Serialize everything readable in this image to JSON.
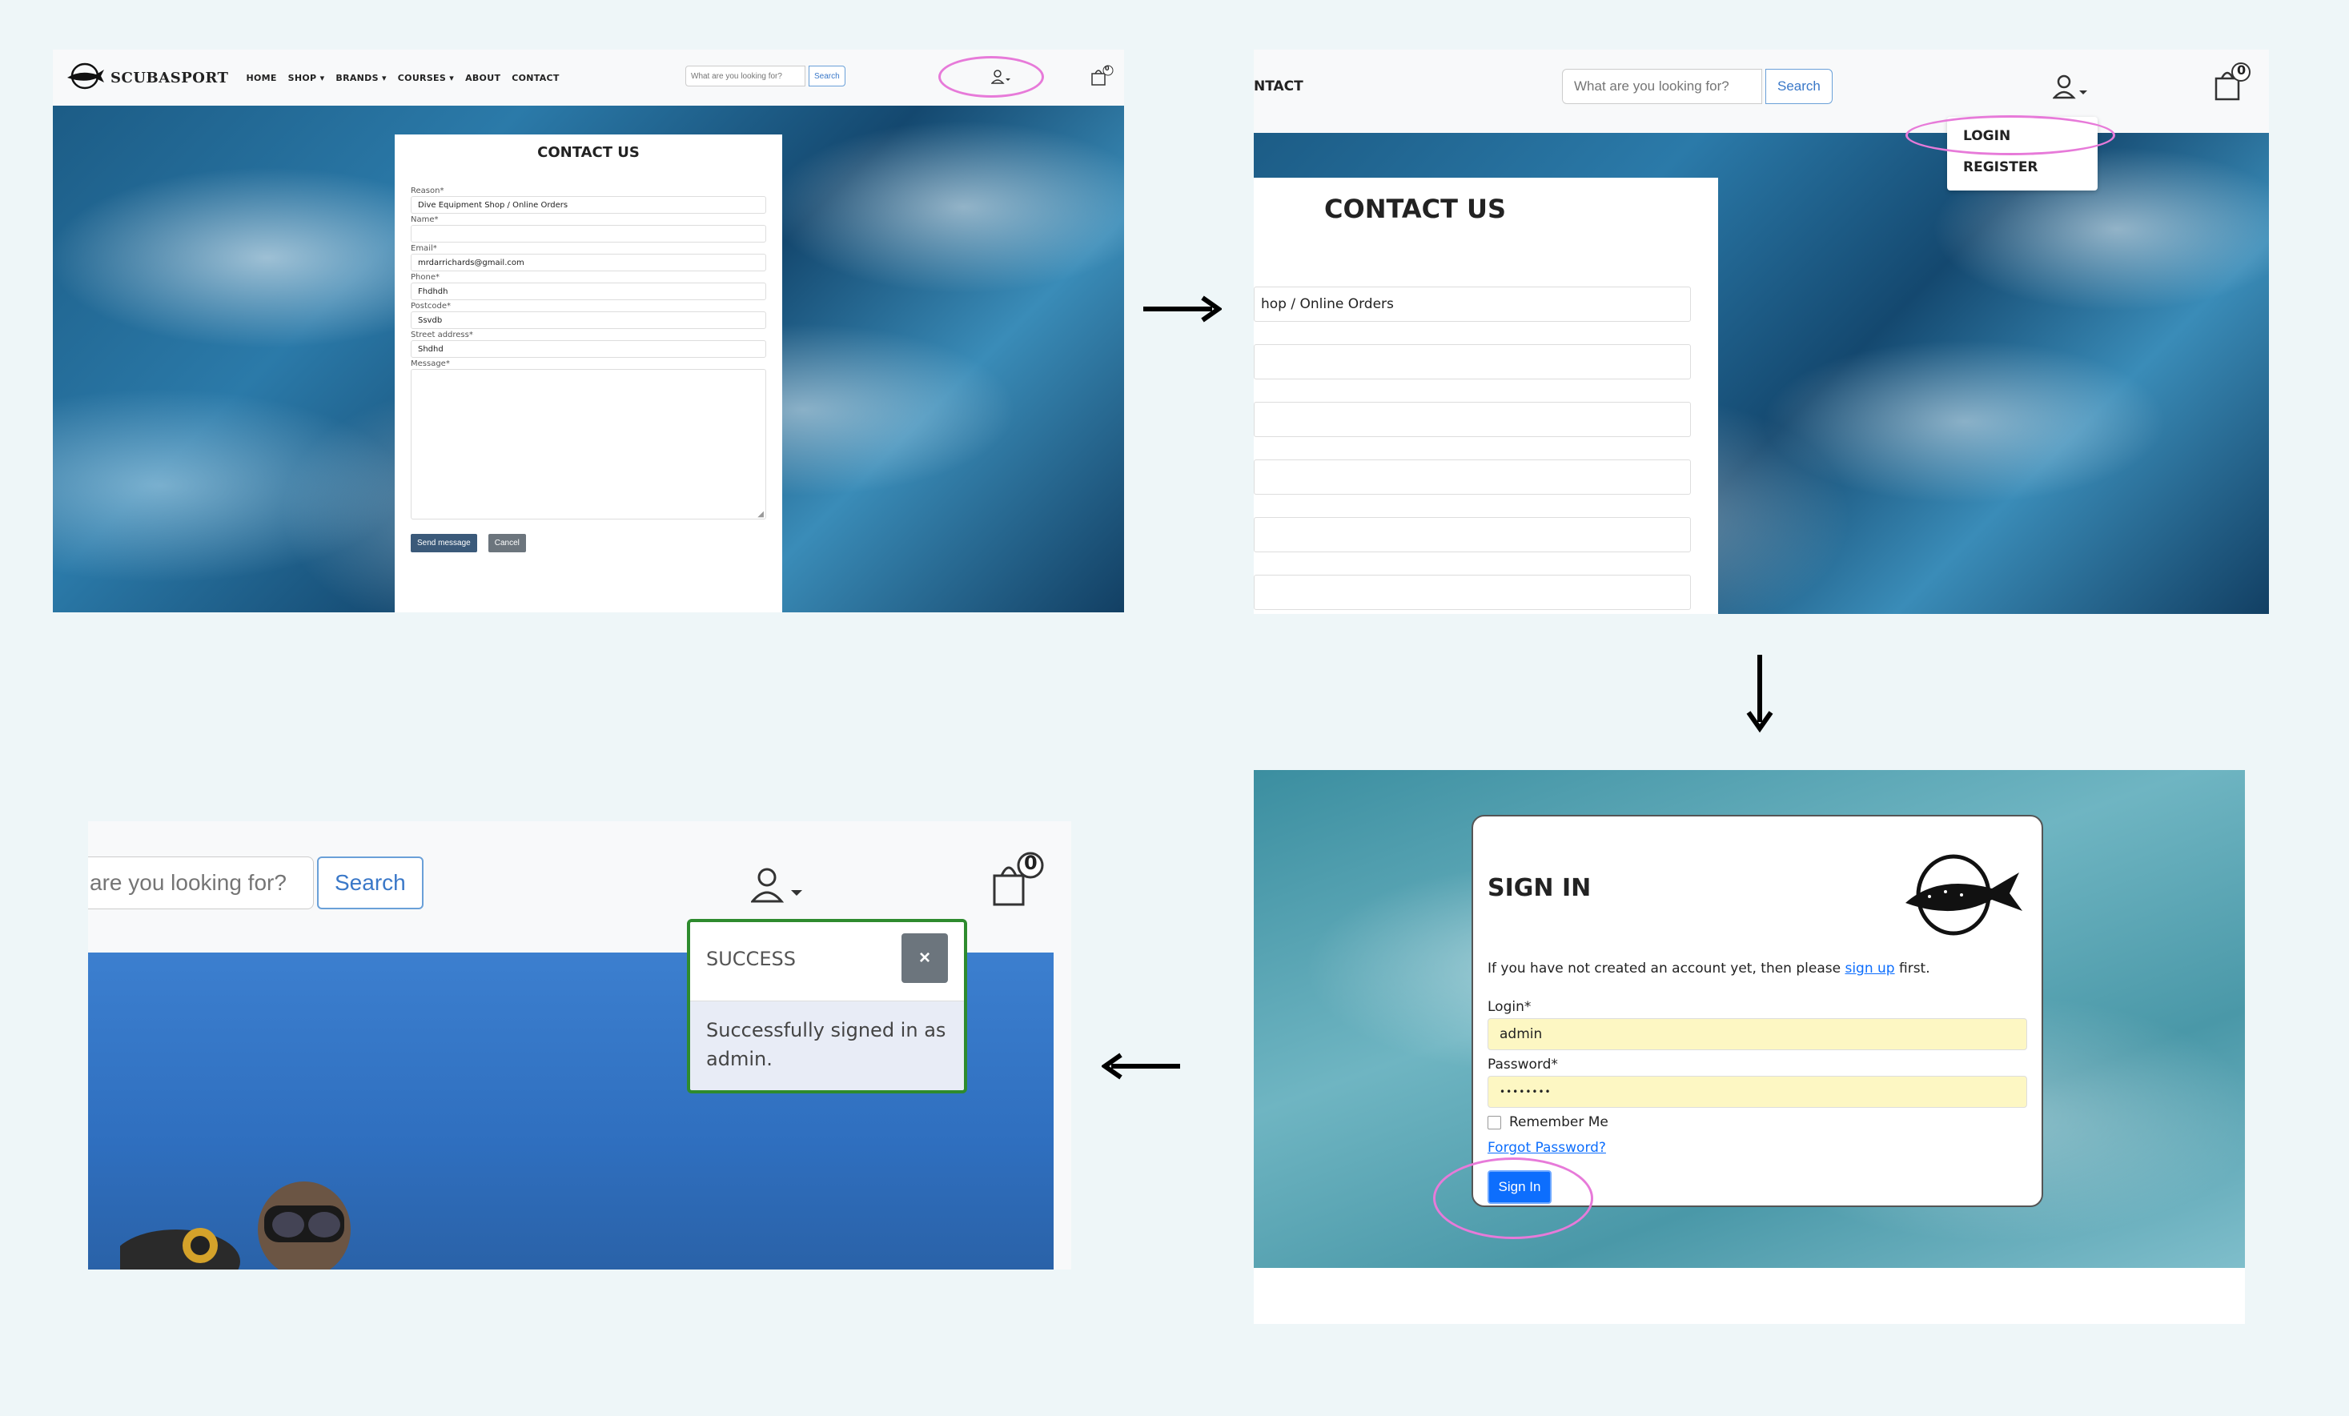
{
  "panel1": {
    "brand": "SCUBASPORT",
    "nav": [
      "HOME",
      "SHOP",
      "BRANDS",
      "COURSES",
      "ABOUT",
      "CONTACT"
    ],
    "search_placeholder": "What are you looking for?",
    "search_button": "Search",
    "cart_count": "0",
    "form_title": "CONTACT US",
    "fields": [
      {
        "label": "Reason*",
        "value": "Dive Equipment Shop / Online Orders"
      },
      {
        "label": "Name*",
        "value": ""
      },
      {
        "label": "Email*",
        "value": "mrdarrichards@gmail.com"
      },
      {
        "label": "Phone*",
        "value": "Fhdhdh"
      },
      {
        "label": "Postcode*",
        "value": "Ssvdb"
      },
      {
        "label": "Street address*",
        "value": "Shdhd"
      }
    ],
    "message_label": "Message*",
    "send_button": "Send message",
    "cancel_button": "Cancel"
  },
  "panel2": {
    "partial_nav": "NTACT",
    "search_placeholder": "What are you looking for?",
    "search_button": "Search",
    "cart_count": "0",
    "menu_items": [
      "LOGIN",
      "REGISTER"
    ],
    "form_title": "CONTACT US",
    "reason_value": "hop / Online Orders"
  },
  "panel3": {
    "title": "SIGN IN",
    "intro_before": "If you have not created an account yet, then please ",
    "intro_link": "sign up",
    "intro_after": " first.",
    "login_label": "Login*",
    "login_value": "admin",
    "password_label": "Password*",
    "password_value": "••••••••",
    "remember_label": "Remember Me",
    "forgot_link": "Forgot Password?",
    "sign_in_button": "Sign In"
  },
  "panel4": {
    "search_placeholder": "are you looking for?",
    "search_button": "Search",
    "cart_count": "0",
    "toast_title": "SUCCESS",
    "toast_close": "×",
    "toast_message": "Successfully signed in as admin."
  },
  "colors": {
    "accent": "#0d6efd",
    "annotation": "#e77ad9",
    "success_border": "#2e8b2e"
  }
}
